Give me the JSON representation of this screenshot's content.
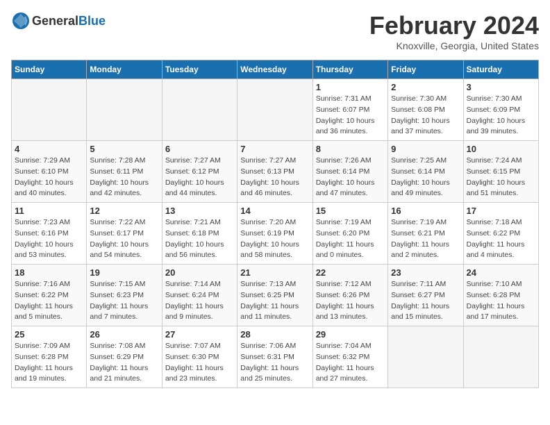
{
  "header": {
    "logo_general": "General",
    "logo_blue": "Blue",
    "month_year": "February 2024",
    "location": "Knoxville, Georgia, United States"
  },
  "days_of_week": [
    "Sunday",
    "Monday",
    "Tuesday",
    "Wednesday",
    "Thursday",
    "Friday",
    "Saturday"
  ],
  "weeks": [
    [
      {
        "day": "",
        "sunrise": "",
        "sunset": "",
        "daylight": ""
      },
      {
        "day": "",
        "sunrise": "",
        "sunset": "",
        "daylight": ""
      },
      {
        "day": "",
        "sunrise": "",
        "sunset": "",
        "daylight": ""
      },
      {
        "day": "",
        "sunrise": "",
        "sunset": "",
        "daylight": ""
      },
      {
        "day": "1",
        "sunrise": "Sunrise: 7:31 AM",
        "sunset": "Sunset: 6:07 PM",
        "daylight": "Daylight: 10 hours and 36 minutes."
      },
      {
        "day": "2",
        "sunrise": "Sunrise: 7:30 AM",
        "sunset": "Sunset: 6:08 PM",
        "daylight": "Daylight: 10 hours and 37 minutes."
      },
      {
        "day": "3",
        "sunrise": "Sunrise: 7:30 AM",
        "sunset": "Sunset: 6:09 PM",
        "daylight": "Daylight: 10 hours and 39 minutes."
      }
    ],
    [
      {
        "day": "4",
        "sunrise": "Sunrise: 7:29 AM",
        "sunset": "Sunset: 6:10 PM",
        "daylight": "Daylight: 10 hours and 40 minutes."
      },
      {
        "day": "5",
        "sunrise": "Sunrise: 7:28 AM",
        "sunset": "Sunset: 6:11 PM",
        "daylight": "Daylight: 10 hours and 42 minutes."
      },
      {
        "day": "6",
        "sunrise": "Sunrise: 7:27 AM",
        "sunset": "Sunset: 6:12 PM",
        "daylight": "Daylight: 10 hours and 44 minutes."
      },
      {
        "day": "7",
        "sunrise": "Sunrise: 7:27 AM",
        "sunset": "Sunset: 6:13 PM",
        "daylight": "Daylight: 10 hours and 46 minutes."
      },
      {
        "day": "8",
        "sunrise": "Sunrise: 7:26 AM",
        "sunset": "Sunset: 6:14 PM",
        "daylight": "Daylight: 10 hours and 47 minutes."
      },
      {
        "day": "9",
        "sunrise": "Sunrise: 7:25 AM",
        "sunset": "Sunset: 6:14 PM",
        "daylight": "Daylight: 10 hours and 49 minutes."
      },
      {
        "day": "10",
        "sunrise": "Sunrise: 7:24 AM",
        "sunset": "Sunset: 6:15 PM",
        "daylight": "Daylight: 10 hours and 51 minutes."
      }
    ],
    [
      {
        "day": "11",
        "sunrise": "Sunrise: 7:23 AM",
        "sunset": "Sunset: 6:16 PM",
        "daylight": "Daylight: 10 hours and 53 minutes."
      },
      {
        "day": "12",
        "sunrise": "Sunrise: 7:22 AM",
        "sunset": "Sunset: 6:17 PM",
        "daylight": "Daylight: 10 hours and 54 minutes."
      },
      {
        "day": "13",
        "sunrise": "Sunrise: 7:21 AM",
        "sunset": "Sunset: 6:18 PM",
        "daylight": "Daylight: 10 hours and 56 minutes."
      },
      {
        "day": "14",
        "sunrise": "Sunrise: 7:20 AM",
        "sunset": "Sunset: 6:19 PM",
        "daylight": "Daylight: 10 hours and 58 minutes."
      },
      {
        "day": "15",
        "sunrise": "Sunrise: 7:19 AM",
        "sunset": "Sunset: 6:20 PM",
        "daylight": "Daylight: 11 hours and 0 minutes."
      },
      {
        "day": "16",
        "sunrise": "Sunrise: 7:19 AM",
        "sunset": "Sunset: 6:21 PM",
        "daylight": "Daylight: 11 hours and 2 minutes."
      },
      {
        "day": "17",
        "sunrise": "Sunrise: 7:18 AM",
        "sunset": "Sunset: 6:22 PM",
        "daylight": "Daylight: 11 hours and 4 minutes."
      }
    ],
    [
      {
        "day": "18",
        "sunrise": "Sunrise: 7:16 AM",
        "sunset": "Sunset: 6:22 PM",
        "daylight": "Daylight: 11 hours and 5 minutes."
      },
      {
        "day": "19",
        "sunrise": "Sunrise: 7:15 AM",
        "sunset": "Sunset: 6:23 PM",
        "daylight": "Daylight: 11 hours and 7 minutes."
      },
      {
        "day": "20",
        "sunrise": "Sunrise: 7:14 AM",
        "sunset": "Sunset: 6:24 PM",
        "daylight": "Daylight: 11 hours and 9 minutes."
      },
      {
        "day": "21",
        "sunrise": "Sunrise: 7:13 AM",
        "sunset": "Sunset: 6:25 PM",
        "daylight": "Daylight: 11 hours and 11 minutes."
      },
      {
        "day": "22",
        "sunrise": "Sunrise: 7:12 AM",
        "sunset": "Sunset: 6:26 PM",
        "daylight": "Daylight: 11 hours and 13 minutes."
      },
      {
        "day": "23",
        "sunrise": "Sunrise: 7:11 AM",
        "sunset": "Sunset: 6:27 PM",
        "daylight": "Daylight: 11 hours and 15 minutes."
      },
      {
        "day": "24",
        "sunrise": "Sunrise: 7:10 AM",
        "sunset": "Sunset: 6:28 PM",
        "daylight": "Daylight: 11 hours and 17 minutes."
      }
    ],
    [
      {
        "day": "25",
        "sunrise": "Sunrise: 7:09 AM",
        "sunset": "Sunset: 6:28 PM",
        "daylight": "Daylight: 11 hours and 19 minutes."
      },
      {
        "day": "26",
        "sunrise": "Sunrise: 7:08 AM",
        "sunset": "Sunset: 6:29 PM",
        "daylight": "Daylight: 11 hours and 21 minutes."
      },
      {
        "day": "27",
        "sunrise": "Sunrise: 7:07 AM",
        "sunset": "Sunset: 6:30 PM",
        "daylight": "Daylight: 11 hours and 23 minutes."
      },
      {
        "day": "28",
        "sunrise": "Sunrise: 7:06 AM",
        "sunset": "Sunset: 6:31 PM",
        "daylight": "Daylight: 11 hours and 25 minutes."
      },
      {
        "day": "29",
        "sunrise": "Sunrise: 7:04 AM",
        "sunset": "Sunset: 6:32 PM",
        "daylight": "Daylight: 11 hours and 27 minutes."
      },
      {
        "day": "",
        "sunrise": "",
        "sunset": "",
        "daylight": ""
      },
      {
        "day": "",
        "sunrise": "",
        "sunset": "",
        "daylight": ""
      }
    ]
  ]
}
